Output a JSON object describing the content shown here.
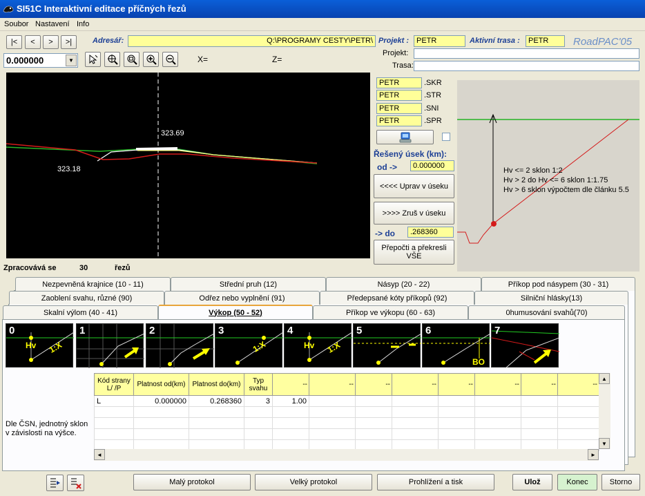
{
  "window": {
    "title": "SI51C Interaktivní editace příčných řezů"
  },
  "menu": [
    "Soubor",
    "Nastavení",
    "Info"
  ],
  "nav": {
    "first": "|<",
    "prev": "<",
    "next": ">",
    "last": ">|"
  },
  "station": "0.000000",
  "coords": {
    "x": "X=",
    "z": "Z="
  },
  "adresar": {
    "label": "Adresář:",
    "value": "Q:\\PROGRAMY CESTY\\PETR\\"
  },
  "projekt": {
    "label": "Projekt :",
    "value": "PETR"
  },
  "trasa_akt": {
    "label": "Aktivní trasa :",
    "value": "PETR"
  },
  "brand": "RoadPAC'05",
  "projekt_name_label": "Projekt:",
  "trasa_name_label": "Trasa:",
  "files": [
    {
      "name": "PETR",
      "ext": ".SKR"
    },
    {
      "name": "PETR",
      "ext": ".STR"
    },
    {
      "name": "PETR",
      "ext": ".SNI"
    },
    {
      "name": "PETR",
      "ext": ".SPR"
    }
  ],
  "usek": {
    "label": "Řešený úsek (km):",
    "od_label": "od ->",
    "od": "0.000000",
    "do_label": "-> do",
    "do": ".268360"
  },
  "buttons": {
    "uprav": "<<<< Uprav v úseku",
    "zrus": ">>>>   Zruš v úseku",
    "prepocti": "Přepočti a překresli VŠE"
  },
  "profile": {
    "elev_top": "323.69",
    "elev_left": "323.18"
  },
  "info": [
    "Hv <= 2 sklon 1:2",
    "Hv > 2 do Hv <= 6 sklon 1:1.75",
    "Hv > 6 sklon výpočtem dle článku 5.5"
  ],
  "status": {
    "label": "Zpracovává se",
    "count": "30",
    "unit": "řezů"
  },
  "tabs": {
    "row1": [
      "Nezpevněná krajnice (10 - 11)",
      "Střední pruh (12)",
      "Násyp (20 - 22)",
      "Příkop pod násypem (30 - 31)"
    ],
    "row2": [
      "Zaoblení svahu, různé (90)",
      "Odřez nebo vyplnění (91)",
      "Předepsané kóty příkopů (92)",
      "Silniční hlásky(13)"
    ],
    "row3": [
      "Skalní výlom (40 - 41)",
      "Výkop (50 - 52)",
      "Příkop ve výkopu (60 - 63)",
      "0humusování svahů(70)"
    ]
  },
  "thumbs": [
    {
      "n": "0",
      "a": "Hv",
      "b": "1:X"
    },
    {
      "n": "1"
    },
    {
      "n": "2"
    },
    {
      "n": "3",
      "b": "1:X"
    },
    {
      "n": "4",
      "a": "Hv",
      "b": "1:X"
    },
    {
      "n": "5"
    },
    {
      "n": "6",
      "a": "BO"
    },
    {
      "n": "7"
    }
  ],
  "table": {
    "headers": [
      "Kód strany L/ /P",
      "Platnost od(km)",
      "Platnost do(km)",
      "Typ svahu",
      "--",
      "--",
      "--",
      "--",
      "--",
      "--",
      "--",
      "--"
    ],
    "rows": [
      [
        "L",
        "0.000000",
        "0.268360",
        "3",
        "1.00"
      ]
    ]
  },
  "note": "Dle ČSN, jednotný sklon v závislosti na výšce.",
  "bottom": {
    "maly": "Malý protokol",
    "velky": "Velký protokol",
    "tisk": "Prohlížení a tisk",
    "uloz": "Ulož",
    "konec": "Konec",
    "storno": "Storno"
  }
}
